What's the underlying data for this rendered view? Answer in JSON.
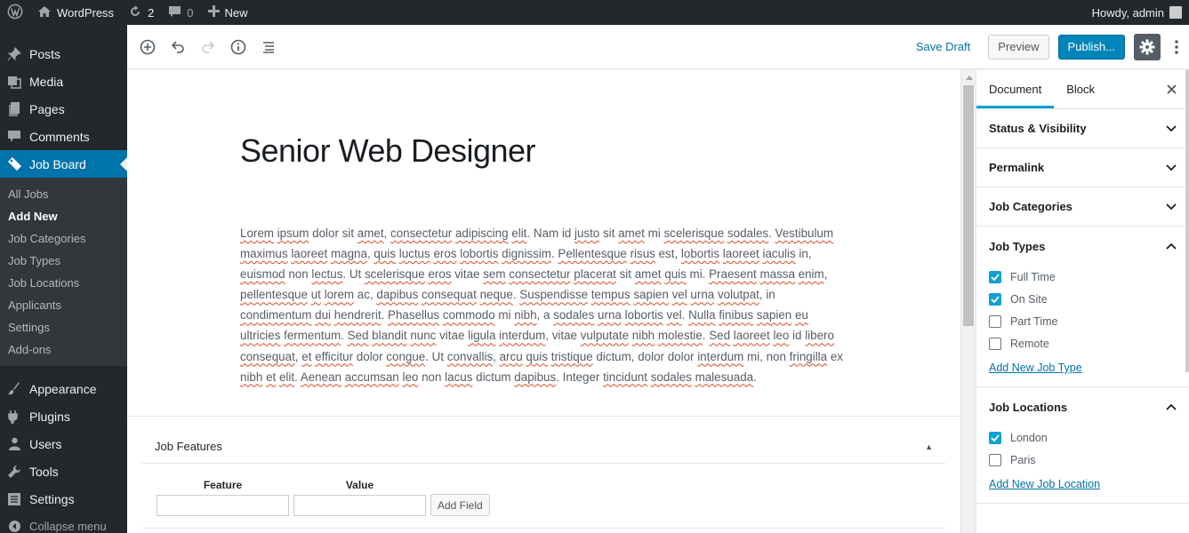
{
  "adminbar": {
    "site_name": "WordPress",
    "updates_count": "2",
    "comments_count": "0",
    "new_label": "New",
    "greeting": "Howdy, admin"
  },
  "menu": {
    "top_items": [
      {
        "label": "Posts",
        "icon": "pin-icon"
      },
      {
        "label": "Media",
        "icon": "media-icon"
      },
      {
        "label": "Pages",
        "icon": "pages-icon"
      },
      {
        "label": "Comments",
        "icon": "comment-icon"
      }
    ],
    "current": {
      "label": "Job Board",
      "icon": "tag-icon"
    },
    "submenu": [
      "All Jobs",
      "Add New",
      "Job Categories",
      "Job Types",
      "Job Locations",
      "Applicants",
      "Settings",
      "Add-ons"
    ],
    "bottom_items": [
      {
        "label": "Appearance",
        "icon": "brush-icon"
      },
      {
        "label": "Plugins",
        "icon": "plugin-icon"
      },
      {
        "label": "Users",
        "icon": "user-icon"
      },
      {
        "label": "Tools",
        "icon": "wrench-icon"
      },
      {
        "label": "Settings",
        "icon": "settings-icon"
      }
    ],
    "collapse_label": "Collapse menu"
  },
  "header": {
    "save_draft": "Save Draft",
    "preview": "Preview",
    "publish": "Publish..."
  },
  "post": {
    "title": "Senior Web Designer",
    "body_words": [
      [
        "Lorem",
        1
      ],
      [
        " ",
        0
      ],
      [
        "ipsum",
        1
      ],
      [
        " dolor sit ",
        0
      ],
      [
        "amet",
        1
      ],
      [
        ", ",
        0
      ],
      [
        "consectetur",
        1
      ],
      [
        " ",
        0
      ],
      [
        "adipiscing",
        1
      ],
      [
        " ",
        0
      ],
      [
        "elit",
        1
      ],
      [
        ". Nam id ",
        0
      ],
      [
        "justo",
        1
      ],
      [
        " sit ",
        0
      ],
      [
        "amet",
        1
      ],
      [
        " mi ",
        0
      ],
      [
        "scelerisque",
        1
      ],
      [
        " ",
        0
      ],
      [
        "sodales",
        1
      ],
      [
        ". ",
        0
      ],
      [
        "Vestibulum",
        1
      ],
      [
        " ",
        0
      ],
      [
        "maximus",
        1
      ],
      [
        " ",
        0
      ],
      [
        "laoreet",
        1
      ],
      [
        " ",
        0
      ],
      [
        "magna",
        1
      ],
      [
        ", ",
        0
      ],
      [
        "quis",
        1
      ],
      [
        " ",
        0
      ],
      [
        "luctus",
        1
      ],
      [
        " ",
        0
      ],
      [
        "eros",
        1
      ],
      [
        " ",
        0
      ],
      [
        "lobortis",
        1
      ],
      [
        " ",
        0
      ],
      [
        "dignissim",
        1
      ],
      [
        ". ",
        0
      ],
      [
        "Pellentesque",
        1
      ],
      [
        " ",
        0
      ],
      [
        "risus",
        1
      ],
      [
        " est, ",
        0
      ],
      [
        "lobortis",
        1
      ],
      [
        " ",
        0
      ],
      [
        "laoreet",
        1
      ],
      [
        " ",
        0
      ],
      [
        "iaculis",
        1
      ],
      [
        " in, ",
        0
      ],
      [
        "euismod",
        1
      ],
      [
        " non ",
        0
      ],
      [
        "lectus",
        1
      ],
      [
        ". Ut ",
        0
      ],
      [
        "scelerisque",
        1
      ],
      [
        " ",
        0
      ],
      [
        "eros",
        1
      ],
      [
        " vitae ",
        0
      ],
      [
        "sem",
        1
      ],
      [
        " ",
        0
      ],
      [
        "consectetur",
        1
      ],
      [
        " ",
        0
      ],
      [
        "placerat",
        1
      ],
      [
        " sit ",
        0
      ],
      [
        "amet",
        1
      ],
      [
        " ",
        0
      ],
      [
        "quis",
        1
      ],
      [
        " mi. ",
        0
      ],
      [
        "Praesent",
        1
      ],
      [
        " ",
        0
      ],
      [
        "massa",
        1
      ],
      [
        " ",
        0
      ],
      [
        "enim",
        1
      ],
      [
        ", ",
        0
      ],
      [
        "pellentesque",
        1
      ],
      [
        " ",
        0
      ],
      [
        "ut",
        1
      ],
      [
        " ",
        0
      ],
      [
        "lorem",
        1
      ],
      [
        " ac, ",
        0
      ],
      [
        "dapibus",
        1
      ],
      [
        " ",
        0
      ],
      [
        "consequat",
        1
      ],
      [
        " ",
        0
      ],
      [
        "neque",
        1
      ],
      [
        ". ",
        0
      ],
      [
        "Suspendisse",
        1
      ],
      [
        " ",
        0
      ],
      [
        "tempus",
        1
      ],
      [
        " ",
        0
      ],
      [
        "sapien",
        1
      ],
      [
        " ",
        0
      ],
      [
        "vel",
        1
      ],
      [
        " ",
        0
      ],
      [
        "urna",
        1
      ],
      [
        " ",
        0
      ],
      [
        "volutpat",
        1
      ],
      [
        ", in ",
        0
      ],
      [
        "condimentum",
        1
      ],
      [
        " ",
        0
      ],
      [
        "dui",
        1
      ],
      [
        " ",
        0
      ],
      [
        "hendrerit",
        1
      ],
      [
        ". ",
        0
      ],
      [
        "Phasellus",
        1
      ],
      [
        " ",
        0
      ],
      [
        "commodo",
        1
      ],
      [
        " mi ",
        0
      ],
      [
        "nibh",
        1
      ],
      [
        ", a ",
        0
      ],
      [
        "sodales",
        1
      ],
      [
        " ",
        0
      ],
      [
        "urna",
        1
      ],
      [
        " ",
        0
      ],
      [
        "lobortis",
        1
      ],
      [
        " ",
        0
      ],
      [
        "vel",
        1
      ],
      [
        ". ",
        0
      ],
      [
        "Nulla",
        1
      ],
      [
        " ",
        0
      ],
      [
        "finibus",
        1
      ],
      [
        " ",
        0
      ],
      [
        "sapien",
        1
      ],
      [
        " ",
        0
      ],
      [
        "eu",
        1
      ],
      [
        " ",
        0
      ],
      [
        "ultricies",
        1
      ],
      [
        " ",
        0
      ],
      [
        "fermentum",
        1
      ],
      [
        ". ",
        0
      ],
      [
        "Sed",
        1
      ],
      [
        " ",
        0
      ],
      [
        "blandit",
        1
      ],
      [
        " ",
        0
      ],
      [
        "nunc",
        1
      ],
      [
        " vitae ",
        0
      ],
      [
        "ligula",
        1
      ],
      [
        " ",
        0
      ],
      [
        "interdum",
        1
      ],
      [
        ", vitae ",
        0
      ],
      [
        "vulputate",
        1
      ],
      [
        " ",
        0
      ],
      [
        "nibh",
        1
      ],
      [
        " ",
        0
      ],
      [
        "molestie",
        1
      ],
      [
        ". ",
        0
      ],
      [
        "Sed",
        1
      ],
      [
        " ",
        0
      ],
      [
        "laoreet",
        1
      ],
      [
        " ",
        0
      ],
      [
        "leo",
        1
      ],
      [
        " id ",
        0
      ],
      [
        "libero",
        1
      ],
      [
        " ",
        0
      ],
      [
        "consequat",
        1
      ],
      [
        ", ",
        0
      ],
      [
        "et",
        1
      ],
      [
        " ",
        0
      ],
      [
        "efficitur",
        1
      ],
      [
        " dolor ",
        0
      ],
      [
        "congue",
        1
      ],
      [
        ". Ut ",
        0
      ],
      [
        "convallis",
        1
      ],
      [
        ", ",
        0
      ],
      [
        "arcu",
        1
      ],
      [
        " ",
        0
      ],
      [
        "quis",
        1
      ],
      [
        " ",
        0
      ],
      [
        "tristique",
        1
      ],
      [
        " dictum, dolor dolor ",
        0
      ],
      [
        "interdum",
        1
      ],
      [
        " mi, non ",
        0
      ],
      [
        "fringilla",
        1
      ],
      [
        " ex ",
        0
      ],
      [
        "nibh",
        1
      ],
      [
        " ",
        0
      ],
      [
        "et",
        1
      ],
      [
        " ",
        0
      ],
      [
        "elit",
        1
      ],
      [
        ". ",
        0
      ],
      [
        "Aenean",
        1
      ],
      [
        " ",
        0
      ],
      [
        "accumsan",
        1
      ],
      [
        " ",
        0
      ],
      [
        "leo",
        1
      ],
      [
        " non ",
        0
      ],
      [
        "lacus",
        1
      ],
      [
        " dictum ",
        0
      ],
      [
        "dapibus",
        1
      ],
      [
        ". Integer ",
        0
      ],
      [
        "tincidunt",
        1
      ],
      [
        " ",
        0
      ],
      [
        "sodales",
        1
      ],
      [
        " ",
        0
      ],
      [
        "malesuada",
        1
      ],
      [
        ".",
        0
      ]
    ]
  },
  "metabox": {
    "title": "Job Features",
    "feature_label": "Feature",
    "value_label": "Value",
    "feature_value": "",
    "value_value": "",
    "add_field": "Add Field"
  },
  "sidebar": {
    "tab_document": "Document",
    "tab_block": "Block",
    "panels": {
      "status": "Status & Visibility",
      "permalink": "Permalink",
      "categories": "Job Categories"
    },
    "job_types": {
      "title": "Job Types",
      "items": [
        {
          "label": "Full Time",
          "checked": true
        },
        {
          "label": "On Site",
          "checked": true
        },
        {
          "label": "Part Time",
          "checked": false
        },
        {
          "label": "Remote",
          "checked": false
        }
      ],
      "add_link": "Add New Job Type"
    },
    "job_locations": {
      "title": "Job Locations",
      "items": [
        {
          "label": "London",
          "checked": true
        },
        {
          "label": "Paris",
          "checked": false
        }
      ],
      "add_link": "Add New Job Location"
    }
  },
  "colors": {
    "admin_dark": "#23282d",
    "accent_blue": "#0073aa",
    "checkbox_blue": "#11a0d2"
  }
}
